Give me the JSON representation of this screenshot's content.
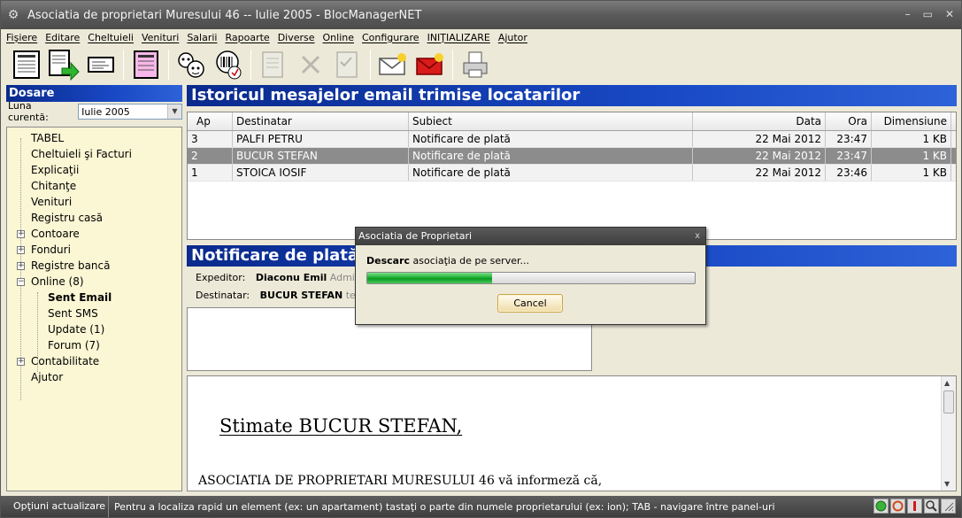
{
  "window": {
    "title": "Asociatia de proprietari Muresului 46 -- Iulie 2005 - BlocManagerNET",
    "minimize": "–",
    "restore": "▭",
    "close": "✕"
  },
  "menu": [
    "Fişiere",
    "Editare",
    "Cheltuieli",
    "Venituri",
    "Salarii",
    "Rapoarte",
    "Diverse",
    "Online",
    "Configurare",
    "INIŢIALIZARE",
    "Ajutor"
  ],
  "toolbar": {
    "icons": [
      "list-sheet-icon",
      "export-green-arrow-icon",
      "calculator-card-icon",
      "pink-sheet-icon",
      "people-scan-icon",
      "barcode-scan-icon",
      "document-icon",
      "delete-x-icon",
      "checklist-icon",
      "email-icon",
      "email-urgent-icon",
      "printer-icon"
    ]
  },
  "left": {
    "header": "Dosare",
    "luna_label": "Luna curentă:",
    "luna_value": "Iulie 2005",
    "tree": [
      {
        "label": "TABEL",
        "level": 0,
        "expand": false
      },
      {
        "label": "Cheltuieli şi Facturi",
        "level": 0,
        "expand": false
      },
      {
        "label": "Explicaţii",
        "level": 0,
        "expand": false
      },
      {
        "label": "Chitanţe",
        "level": 0,
        "expand": false
      },
      {
        "label": "Venituri",
        "level": 0,
        "expand": false
      },
      {
        "label": "Registru casă",
        "level": 0,
        "expand": false
      },
      {
        "label": "Contoare",
        "level": 0,
        "expand": "+"
      },
      {
        "label": "Fonduri",
        "level": 0,
        "expand": "+"
      },
      {
        "label": "Registre bancă",
        "level": 0,
        "expand": "+"
      },
      {
        "label": "Online (8)",
        "level": 0,
        "expand": "−"
      },
      {
        "label": "Sent Email",
        "level": 1,
        "expand": false,
        "bold": true
      },
      {
        "label": "Sent SMS",
        "level": 1,
        "expand": false
      },
      {
        "label": "Update (1)",
        "level": 1,
        "expand": false
      },
      {
        "label": "Forum (7)",
        "level": 1,
        "expand": false
      },
      {
        "label": "Contabilitate",
        "level": 0,
        "expand": "+"
      },
      {
        "label": "Ajutor",
        "level": 0,
        "expand": false
      }
    ]
  },
  "history": {
    "header": "Istoricul mesajelor email trimise locatarilor",
    "columns": {
      "ap": "Ap",
      "dest": "Destinatar",
      "subj": "Subiect",
      "data": "Data",
      "ora": "Ora",
      "dim": "Dimensiune"
    },
    "rows": [
      {
        "ap": "3",
        "dest": "PALFI PETRU",
        "subj": "Notificare de plată",
        "data": "22 Mai 2012",
        "ora": "23:47",
        "dim": "1 KB"
      },
      {
        "ap": "2",
        "dest": "BUCUR STEFAN",
        "subj": "Notificare de plată",
        "data": "22 Mai 2012",
        "ora": "23:47",
        "dim": "1 KB"
      },
      {
        "ap": "1",
        "dest": "STOICA IOSIF",
        "subj": "Notificare de plată",
        "data": "22 Mai 2012",
        "ora": "23:46",
        "dim": "1 KB"
      }
    ]
  },
  "message": {
    "header": "Notificare de plată",
    "exp_label": "Expeditor:",
    "exp_name": "Diaconu Emil",
    "exp_extra": "Administ",
    "dest_label": "Destinatar:",
    "dest_name": "BUCUR STEFAN",
    "dest_extra": "test@",
    "greeting": "Stimate BUCUR STEFAN,",
    "body": "ASOCIATIA DE PROPRIETARI MURESULUI 46 vă informeză că,"
  },
  "dialog": {
    "title": "Asociatia de Proprietari",
    "close": "x",
    "msg_bold": "Descarc",
    "msg_rest": " asociaţia de pe server...",
    "progress": 0.38,
    "cancel": "Cancel"
  },
  "status": {
    "left": "Opţiuni actualizare",
    "hint": "Pentru a localiza rapid un element (ex: un apartament) tastaţi o parte din numele proprietarului (ex: ion); TAB - navigare între panel-uri"
  }
}
